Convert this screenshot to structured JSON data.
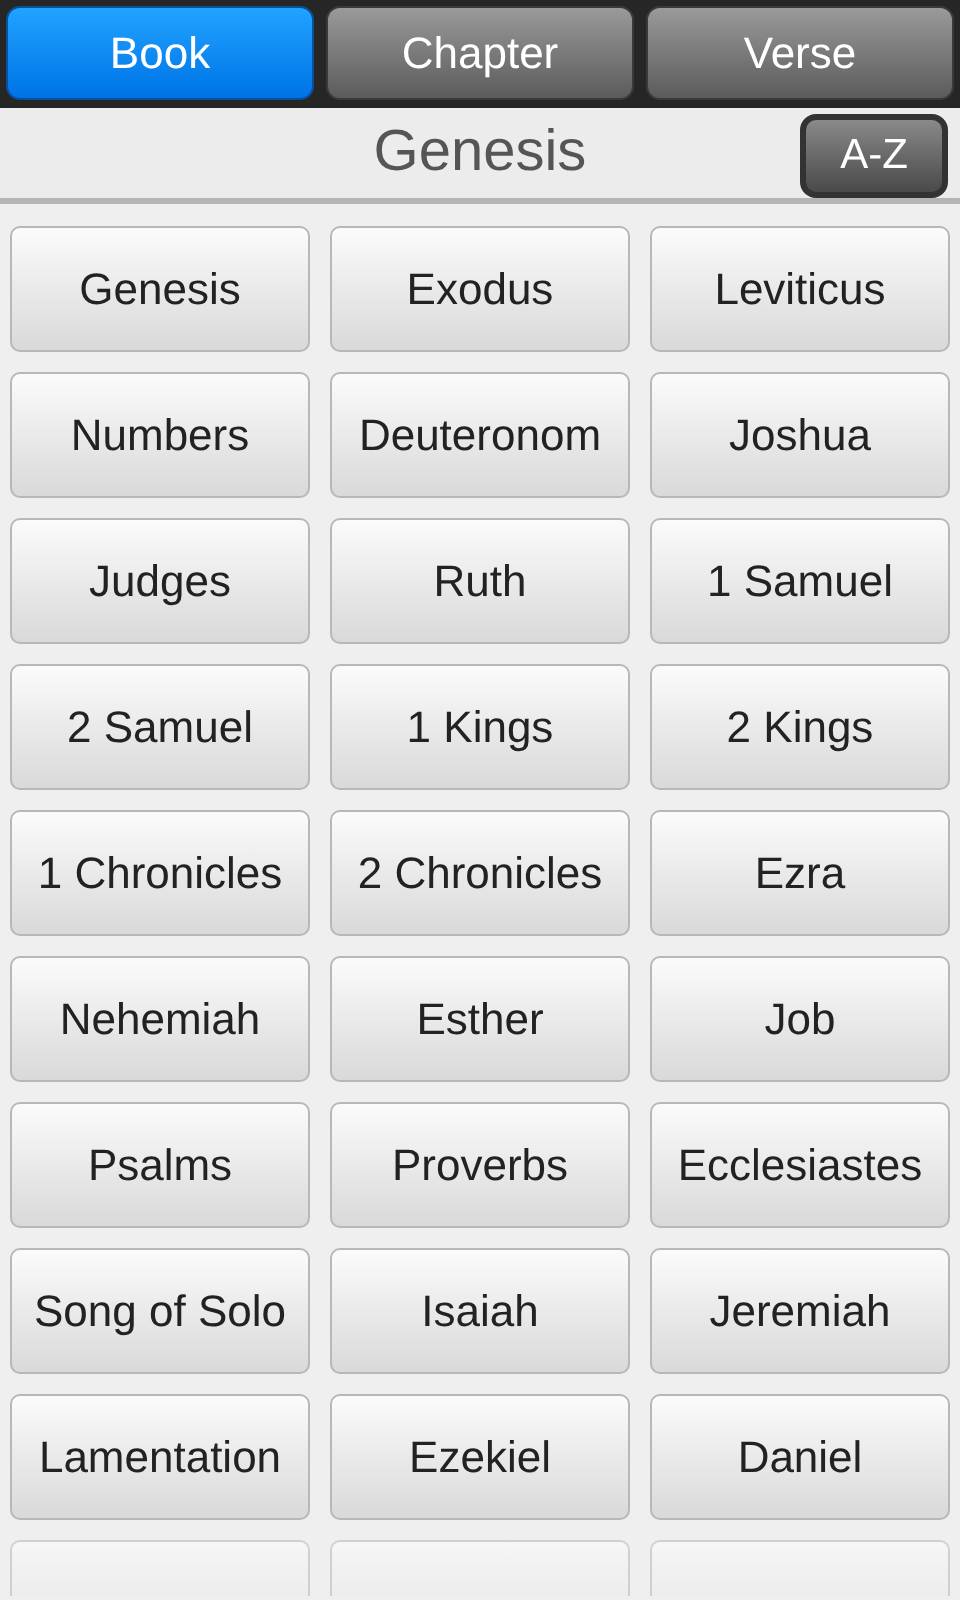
{
  "tabs": [
    {
      "label": "Book",
      "selected": true
    },
    {
      "label": "Chapter",
      "selected": false
    },
    {
      "label": "Verse",
      "selected": false
    }
  ],
  "header": {
    "title": "Genesis",
    "sort_button": "A-Z"
  },
  "books": [
    "Genesis",
    "Exodus",
    "Leviticus",
    "Numbers",
    "Deuteronom",
    "Joshua",
    "Judges",
    "Ruth",
    "1 Samuel",
    "2 Samuel",
    "1 Kings",
    "2 Kings",
    "1 Chronicles",
    "2 Chronicles",
    "Ezra",
    "Nehemiah",
    "Esther",
    "Job",
    "Psalms",
    "Proverbs",
    "Ecclesiastes",
    "Song of Solo",
    "Isaiah",
    "Jeremiah",
    "Lamentation",
    "Ezekiel",
    "Daniel"
  ]
}
